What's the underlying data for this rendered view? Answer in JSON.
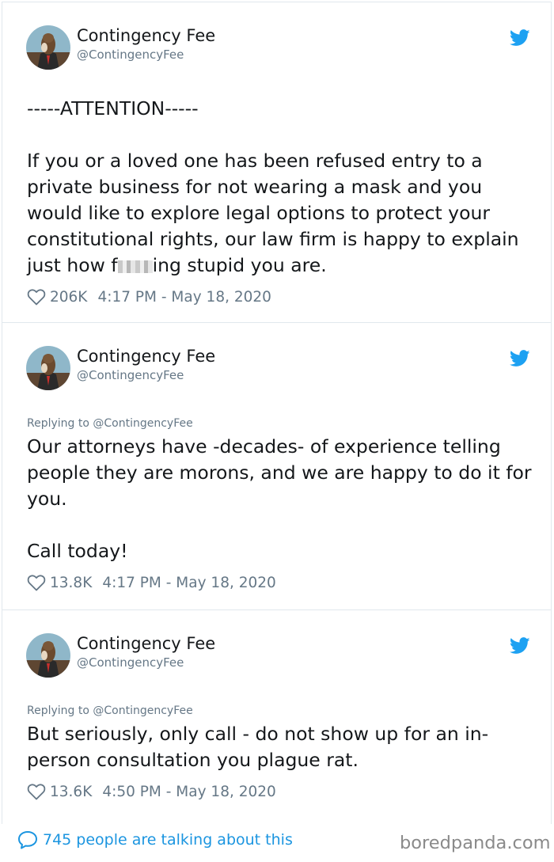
{
  "tweets": [
    {
      "name": "Contingency Fee",
      "handle": "@ContingencyFee",
      "reply_to": "",
      "text_before_censor": "-----ATTENTION-----\n\nIf you or a loved one has been refused entry to a private business for not wearing a mask and you would like to explore legal options to protect your constitutional rights, our law firm is happy to explain just how f",
      "text_after_censor": "ing stupid you are.",
      "likes": "206K",
      "timestamp": "4:17 PM - May 18, 2020"
    },
    {
      "name": "Contingency Fee",
      "handle": "@ContingencyFee",
      "reply_to": "Replying to @ContingencyFee",
      "text": "Our attorneys have -decades- of experience telling people they are morons, and we are happy to do it for you.\n\nCall today!",
      "likes": "13.8K",
      "timestamp": "4:17 PM - May 18, 2020"
    },
    {
      "name": "Contingency Fee",
      "handle": "@ContingencyFee",
      "reply_to": "Replying to @ContingencyFee",
      "text": "But seriously, only call - do not show up for an in-person consultation you plague rat.",
      "likes": "13.6K",
      "timestamp": "4:50 PM - May 18, 2020"
    }
  ],
  "footer": {
    "talking": "745 people are talking about this",
    "brand": "boredpanda.com"
  },
  "icons": {
    "verified_bird": "twitter-bird-icon",
    "heart": "heart-icon",
    "speech": "speech-bubble-icon"
  },
  "colors": {
    "twitter_blue": "#1da1f2",
    "link_blue": "#1b95e0",
    "meta_gray": "#657786"
  }
}
